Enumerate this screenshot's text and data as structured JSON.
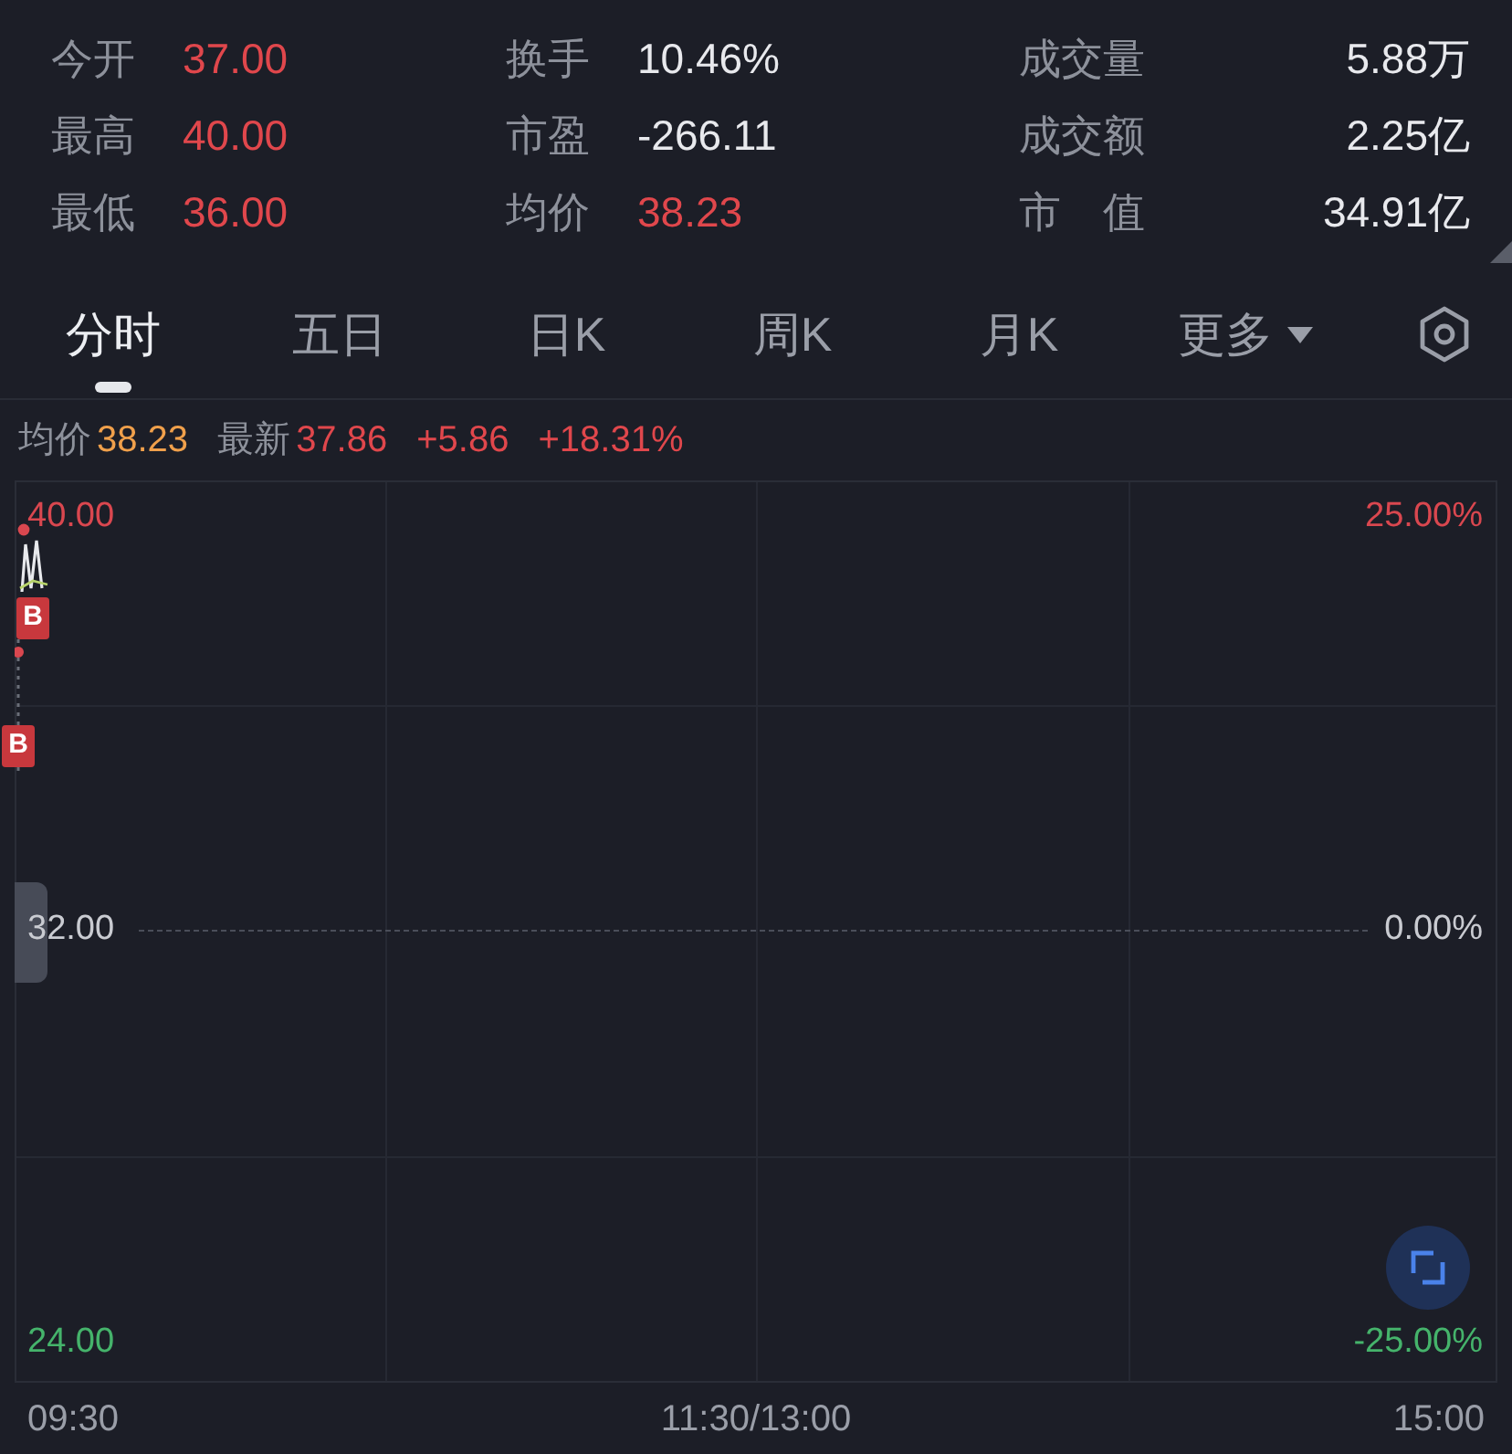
{
  "stats": [
    {
      "label": "今开",
      "value": "37.00",
      "color": "#e0474c"
    },
    {
      "label": "换手",
      "value": "10.46%",
      "color": "#e8e9ed"
    },
    {
      "label": "成交量",
      "value": "5.88万",
      "color": "#e8e9ed"
    },
    {
      "label": "最高",
      "value": "40.00",
      "color": "#e0474c"
    },
    {
      "label": "市盈",
      "value": "-266.11",
      "color": "#e8e9ed"
    },
    {
      "label": "成交额",
      "value": "2.25亿",
      "color": "#e8e9ed"
    },
    {
      "label": "最低",
      "value": "36.00",
      "color": "#e0474c"
    },
    {
      "label": "均价",
      "value": "38.23",
      "color": "#e0474c"
    },
    {
      "label": "市　值",
      "value": "34.91亿",
      "color": "#e8e9ed"
    }
  ],
  "tabs": [
    {
      "label": "分时",
      "selected": true,
      "kind": "tab"
    },
    {
      "label": "五日",
      "selected": false,
      "kind": "tab"
    },
    {
      "label": "日K",
      "selected": false,
      "kind": "tab"
    },
    {
      "label": "周K",
      "selected": false,
      "kind": "tab"
    },
    {
      "label": "月K",
      "selected": false,
      "kind": "tab"
    },
    {
      "label": "更多",
      "selected": false,
      "kind": "menu"
    }
  ],
  "price_summary": [
    {
      "label": "均价",
      "value": "38.23",
      "color": "#f0a04b"
    },
    {
      "label": "最新",
      "value": "37.86",
      "color": "#e0474c"
    },
    {
      "value": "+5.86",
      "color": "#e0474c"
    },
    {
      "value": "+18.31%",
      "color": "#e0474c"
    }
  ],
  "chart": {
    "y_axis": [
      {
        "price": "40.00",
        "percent": "25.00%",
        "color": "#d9474f"
      },
      {
        "price": "32.00",
        "percent": "0.00%",
        "color": "#c9cbd1"
      },
      {
        "price": "24.00",
        "percent": "-25.00%",
        "color": "#45b36b"
      }
    ],
    "trade_markers": [
      {
        "text": "B"
      },
      {
        "text": "B"
      }
    ],
    "time_axis": [
      "09:30",
      "11:30/13:00",
      "15:00"
    ]
  }
}
